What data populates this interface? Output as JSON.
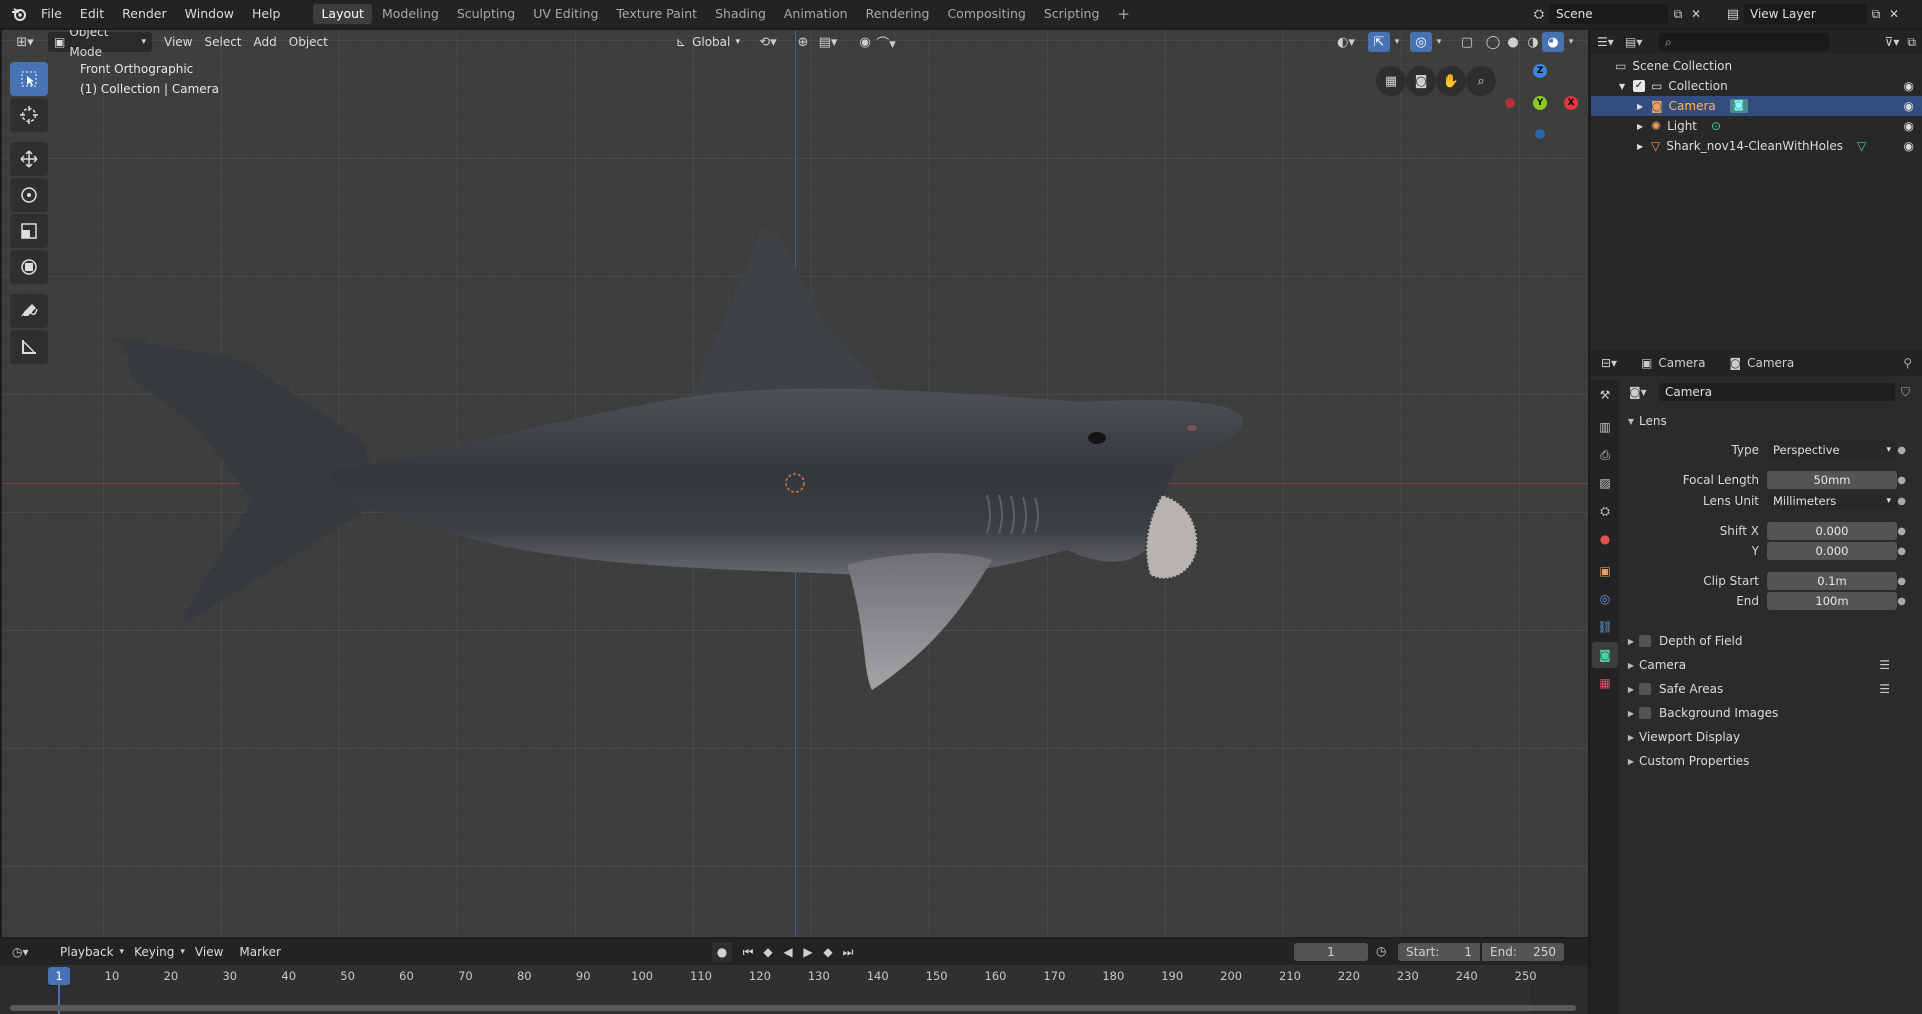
{
  "topbar": {
    "menus": [
      "File",
      "Edit",
      "Render",
      "Window",
      "Help"
    ],
    "workspaces": [
      "Layout",
      "Modeling",
      "Sculpting",
      "UV Editing",
      "Texture Paint",
      "Shading",
      "Animation",
      "Rendering",
      "Compositing",
      "Scripting"
    ],
    "active_workspace": "Layout",
    "add_tab": "+",
    "scene": "Scene",
    "view_layer": "View Layer"
  },
  "viewport": {
    "mode": "Object Mode",
    "menus": [
      "View",
      "Select",
      "Add",
      "Object"
    ],
    "orientation": "Global",
    "view_name": "Front Orthographic",
    "collection_info": "(1) Collection | Camera",
    "gizmo": {
      "z": "Z",
      "y": "Y",
      "x": "X"
    }
  },
  "outliner": {
    "search_placeholder": "",
    "root": "Scene Collection",
    "collection": "Collection",
    "items": [
      {
        "name": "Camera",
        "selected": true
      },
      {
        "name": "Light",
        "selected": false
      },
      {
        "name": "Shark_nov14-CleanWithHoles",
        "selected": false
      }
    ]
  },
  "properties": {
    "breadcrumb_object": "Camera",
    "breadcrumb_data": "Camera",
    "datablock": "Camera",
    "lens_header": "Lens",
    "type_label": "Type",
    "type_value": "Perspective",
    "focal_label": "Focal Length",
    "focal_value": "50mm",
    "unit_label": "Lens Unit",
    "unit_value": "Millimeters",
    "shiftx_label": "Shift X",
    "shiftx_value": "0.000",
    "shifty_label": "Y",
    "shifty_value": "0.000",
    "clipstart_label": "Clip Start",
    "clipstart_value": "0.1m",
    "clipend_label": "End",
    "clipend_value": "100m",
    "sections": [
      "Depth of Field",
      "Camera",
      "Safe Areas",
      "Background Images",
      "Viewport Display",
      "Custom Properties"
    ]
  },
  "timeline": {
    "menus": [
      "Playback",
      "Keying",
      "View",
      "Marker"
    ],
    "current_frame": "1",
    "start_label": "Start:",
    "start_value": "1",
    "end_label": "End:",
    "end_value": "250",
    "ruler": [
      "10",
      "20",
      "30",
      "40",
      "50",
      "60",
      "70",
      "80",
      "90",
      "100",
      "110",
      "120",
      "130",
      "140",
      "150",
      "160",
      "170",
      "180",
      "190",
      "200",
      "210",
      "220",
      "230",
      "240",
      "250"
    ],
    "playhead": "1"
  },
  "colors": {
    "accent": "#4772b3",
    "selected_row": "#334d80",
    "x_axis": "#e2383d",
    "y_axis": "#8ec82b",
    "z_axis": "#3d85e0"
  }
}
